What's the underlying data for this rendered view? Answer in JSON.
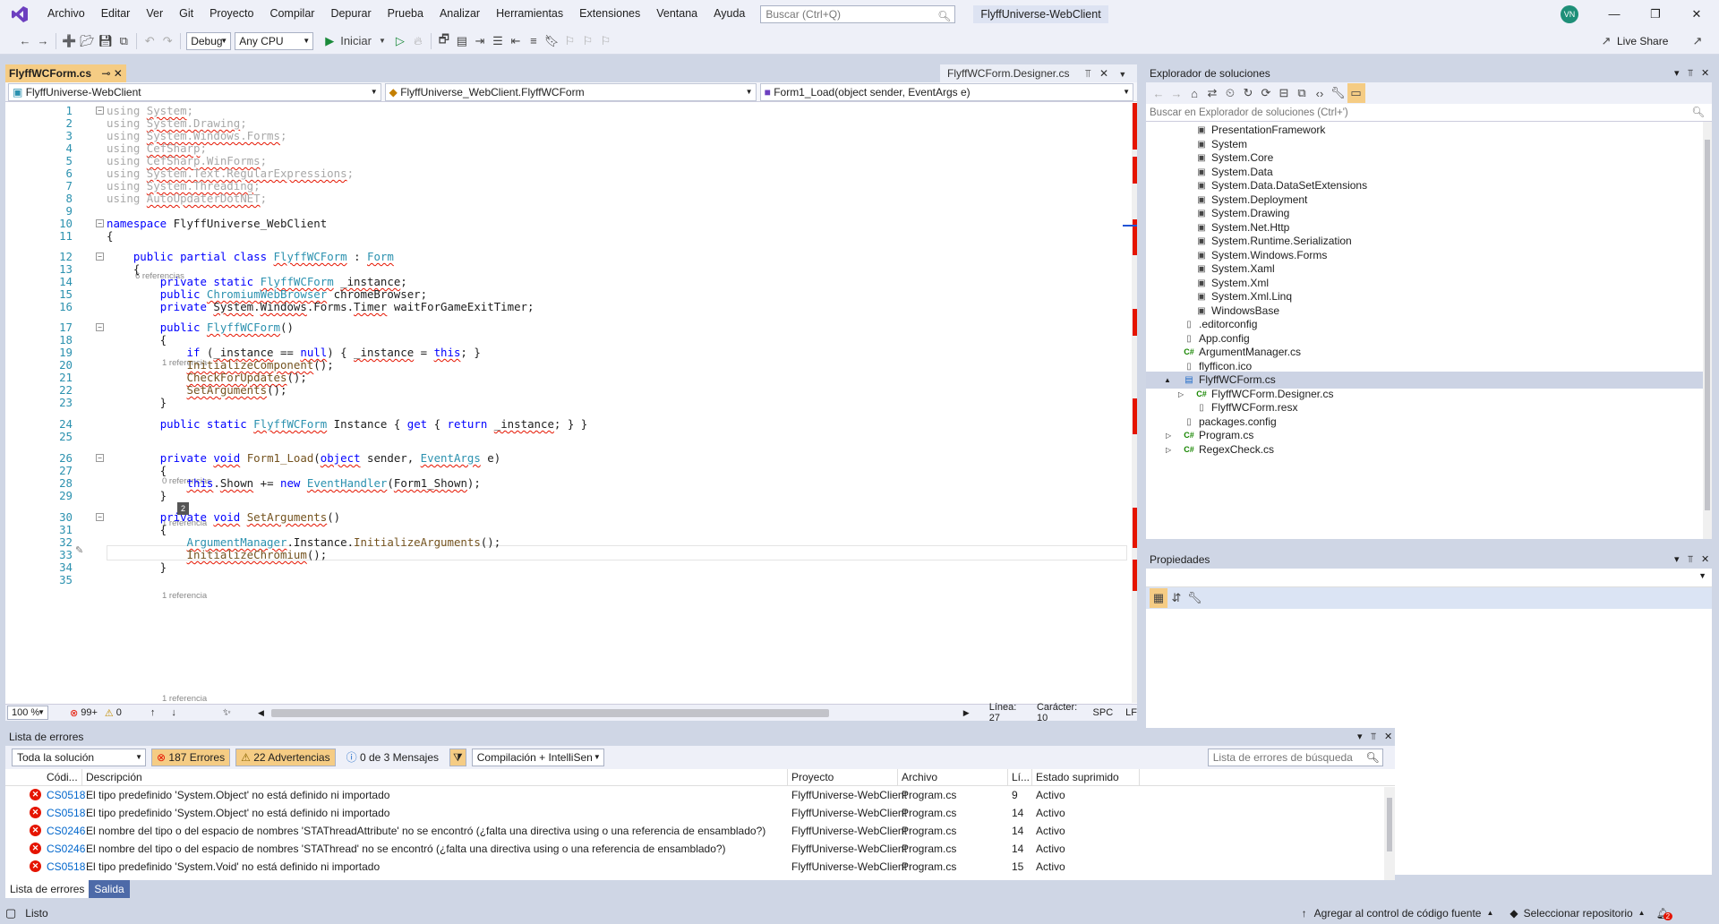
{
  "menu": [
    "Archivo",
    "Editar",
    "Ver",
    "Git",
    "Proyecto",
    "Compilar",
    "Depurar",
    "Prueba",
    "Analizar",
    "Herramientas",
    "Extensiones",
    "Ventana",
    "Ayuda"
  ],
  "search_placeholder": "Buscar (Ctrl+Q)",
  "window_title": "FlyffUniverse-WebClient",
  "avatar_initials": "VN",
  "toolbar": {
    "config": "Debug",
    "platform": "Any CPU",
    "start": "Iniciar",
    "live_share": "Live Share"
  },
  "tabs": {
    "active": "FlyffWCForm.cs",
    "active_glyphs": "⊸ ✕",
    "other": "FlyffWCForm.Designer.cs"
  },
  "nav": {
    "project": "FlyffUniverse-WebClient",
    "class": "FlyffUniverse_WebClient.FlyffWCForm",
    "member": "Form1_Load(object sender, EventArgs e)"
  },
  "code": {
    "lens_6": "6 referencias",
    "lens_1": "1 referencia",
    "lens_0": "0 referencias",
    "hint": "2",
    "lines": [
      {
        "n": "1",
        "t": "using System;"
      },
      {
        "n": "2",
        "t": "using System.Drawing;"
      },
      {
        "n": "3",
        "t": "using System.Windows.Forms;"
      },
      {
        "n": "4",
        "t": "using CefSharp;"
      },
      {
        "n": "5",
        "t": "using CefSharp.WinForms;"
      },
      {
        "n": "6",
        "t": "using System.Text.RegularExpressions;"
      },
      {
        "n": "7",
        "t": "using System.Threading;"
      },
      {
        "n": "8",
        "t": "using AutoUpdaterDotNET;"
      },
      {
        "n": "9",
        "t": ""
      },
      {
        "n": "10",
        "t": "namespace FlyffUniverse_WebClient"
      },
      {
        "n": "11",
        "t": "{"
      },
      {
        "n": "12",
        "t": "    public partial class FlyffWCForm : Form"
      },
      {
        "n": "13",
        "t": "    {"
      },
      {
        "n": "14",
        "t": "        private static FlyffWCForm _instance;"
      },
      {
        "n": "15",
        "t": "        public ChromiumWebBrowser chromeBrowser;"
      },
      {
        "n": "16",
        "t": "        private System.Windows.Forms.Timer waitForGameExitTimer;"
      },
      {
        "n": "17",
        "t": "        public FlyffWCForm()"
      },
      {
        "n": "18",
        "t": "        {"
      },
      {
        "n": "19",
        "t": "            if (_instance == null) { _instance = this; }"
      },
      {
        "n": "20",
        "t": "            InitializeComponent();"
      },
      {
        "n": "21",
        "t": "            CheckForUpdates();"
      },
      {
        "n": "22",
        "t": "            SetArguments();"
      },
      {
        "n": "23",
        "t": "        }"
      },
      {
        "n": "24",
        "t": "        public static FlyffWCForm Instance { get { return _instance; } }"
      },
      {
        "n": "25",
        "t": ""
      },
      {
        "n": "26",
        "t": "        private void Form1_Load(object sender, EventArgs e)"
      },
      {
        "n": "27",
        "t": "        {"
      },
      {
        "n": "28",
        "t": "            this.Shown += new EventHandler(Form1_Shown);"
      },
      {
        "n": "29",
        "t": "        }"
      },
      {
        "n": "30",
        "t": "        private void SetArguments()"
      },
      {
        "n": "31",
        "t": "        {"
      },
      {
        "n": "32",
        "t": "            ArgumentManager.Instance.InitializeArguments();"
      },
      {
        "n": "33",
        "t": "            InitializeChromium();"
      },
      {
        "n": "34",
        "t": "        }"
      },
      {
        "n": "35",
        "t": ""
      }
    ]
  },
  "editor_status": {
    "zoom": "100 %",
    "errors": "99+",
    "warnings": "0",
    "line": "Línea: 27",
    "char": "Carácter: 10",
    "spc": "SPC",
    "lf": "LF"
  },
  "solution": {
    "title": "Explorador de soluciones",
    "search": "Buscar en Explorador de soluciones (Ctrl+')",
    "items": [
      {
        "label": "PresentationFramework",
        "level": 3,
        "icon": "ref"
      },
      {
        "label": "System",
        "level": 3,
        "icon": "ref"
      },
      {
        "label": "System.Core",
        "level": 3,
        "icon": "ref"
      },
      {
        "label": "System.Data",
        "level": 3,
        "icon": "ref"
      },
      {
        "label": "System.Data.DataSetExtensions",
        "level": 3,
        "icon": "ref"
      },
      {
        "label": "System.Deployment",
        "level": 3,
        "icon": "ref"
      },
      {
        "label": "System.Drawing",
        "level": 3,
        "icon": "ref"
      },
      {
        "label": "System.Net.Http",
        "level": 3,
        "icon": "ref"
      },
      {
        "label": "System.Runtime.Serialization",
        "level": 3,
        "icon": "ref"
      },
      {
        "label": "System.Windows.Forms",
        "level": 3,
        "icon": "ref"
      },
      {
        "label": "System.Xaml",
        "level": 3,
        "icon": "ref"
      },
      {
        "label": "System.Xml",
        "level": 3,
        "icon": "ref"
      },
      {
        "label": "System.Xml.Linq",
        "level": 3,
        "icon": "ref"
      },
      {
        "label": "WindowsBase",
        "level": 3,
        "icon": "ref"
      },
      {
        "label": ".editorconfig",
        "level": 2,
        "icon": "file"
      },
      {
        "label": "App.config",
        "level": 2,
        "icon": "file"
      },
      {
        "label": "ArgumentManager.cs",
        "level": 2,
        "icon": "cs"
      },
      {
        "label": "flyfficon.ico",
        "level": 2,
        "icon": "file"
      },
      {
        "label": "FlyffWCForm.cs",
        "level": 2,
        "icon": "form",
        "expand": "▲",
        "selected": true
      },
      {
        "label": "FlyffWCForm.Designer.cs",
        "level": 3,
        "icon": "cs",
        "expand": "▷"
      },
      {
        "label": "FlyffWCForm.resx",
        "level": 3,
        "icon": "file"
      },
      {
        "label": "packages.config",
        "level": 2,
        "icon": "file"
      },
      {
        "label": "Program.cs",
        "level": 2,
        "icon": "cs",
        "expand": "▷"
      },
      {
        "label": "RegexCheck.cs",
        "level": 2,
        "icon": "cs",
        "expand": "▷"
      }
    ]
  },
  "properties": {
    "title": "Propiedades"
  },
  "errors": {
    "title": "Lista de errores",
    "scope": "Toda la solución",
    "errors_btn": "187 Errores",
    "warnings_btn": "22 Advertencias",
    "messages_btn": "0 de 3 Mensajes",
    "build": "Compilación + IntelliSen",
    "search": "Lista de errores de búsqueda",
    "columns": [
      "Códi...",
      "Descripción",
      "Proyecto",
      "Archivo",
      "Lí...",
      "Estado suprimido"
    ],
    "rows": [
      {
        "code": "CS0518",
        "desc": "El tipo predefinido 'System.Object' no está definido ni importado",
        "project": "FlyffUniverse-WebClient",
        "file": "Program.cs",
        "line": "9",
        "state": "Activo"
      },
      {
        "code": "CS0518",
        "desc": "El tipo predefinido 'System.Object' no está definido ni importado",
        "project": "FlyffUniverse-WebClient",
        "file": "Program.cs",
        "line": "14",
        "state": "Activo"
      },
      {
        "code": "CS0246",
        "desc": "El nombre del tipo o del espacio de nombres 'STAThreadAttribute' no se encontró (¿falta una directiva using o una referencia de ensamblado?)",
        "project": "FlyffUniverse-WebClient",
        "file": "Program.cs",
        "line": "14",
        "state": "Activo"
      },
      {
        "code": "CS0246",
        "desc": "El nombre del tipo o del espacio de nombres 'STAThread' no se encontró (¿falta una directiva using o una referencia de ensamblado?)",
        "project": "FlyffUniverse-WebClient",
        "file": "Program.cs",
        "line": "14",
        "state": "Activo"
      },
      {
        "code": "CS0518",
        "desc": "El tipo predefinido 'System.Void' no está definido ni importado",
        "project": "FlyffUniverse-WebClient",
        "file": "Program.cs",
        "line": "15",
        "state": "Activo"
      }
    ],
    "bottom_tabs": [
      "Lista de errores",
      "Salida"
    ]
  },
  "status": {
    "ready": "Listo",
    "source_control": "Agregar al control de código fuente",
    "repo": "Seleccionar repositorio",
    "notif": "2"
  },
  "colors": {
    "accent": "#f5cc84",
    "error": "#e51400",
    "keyword": "#0000ff",
    "type": "#2b91af"
  }
}
